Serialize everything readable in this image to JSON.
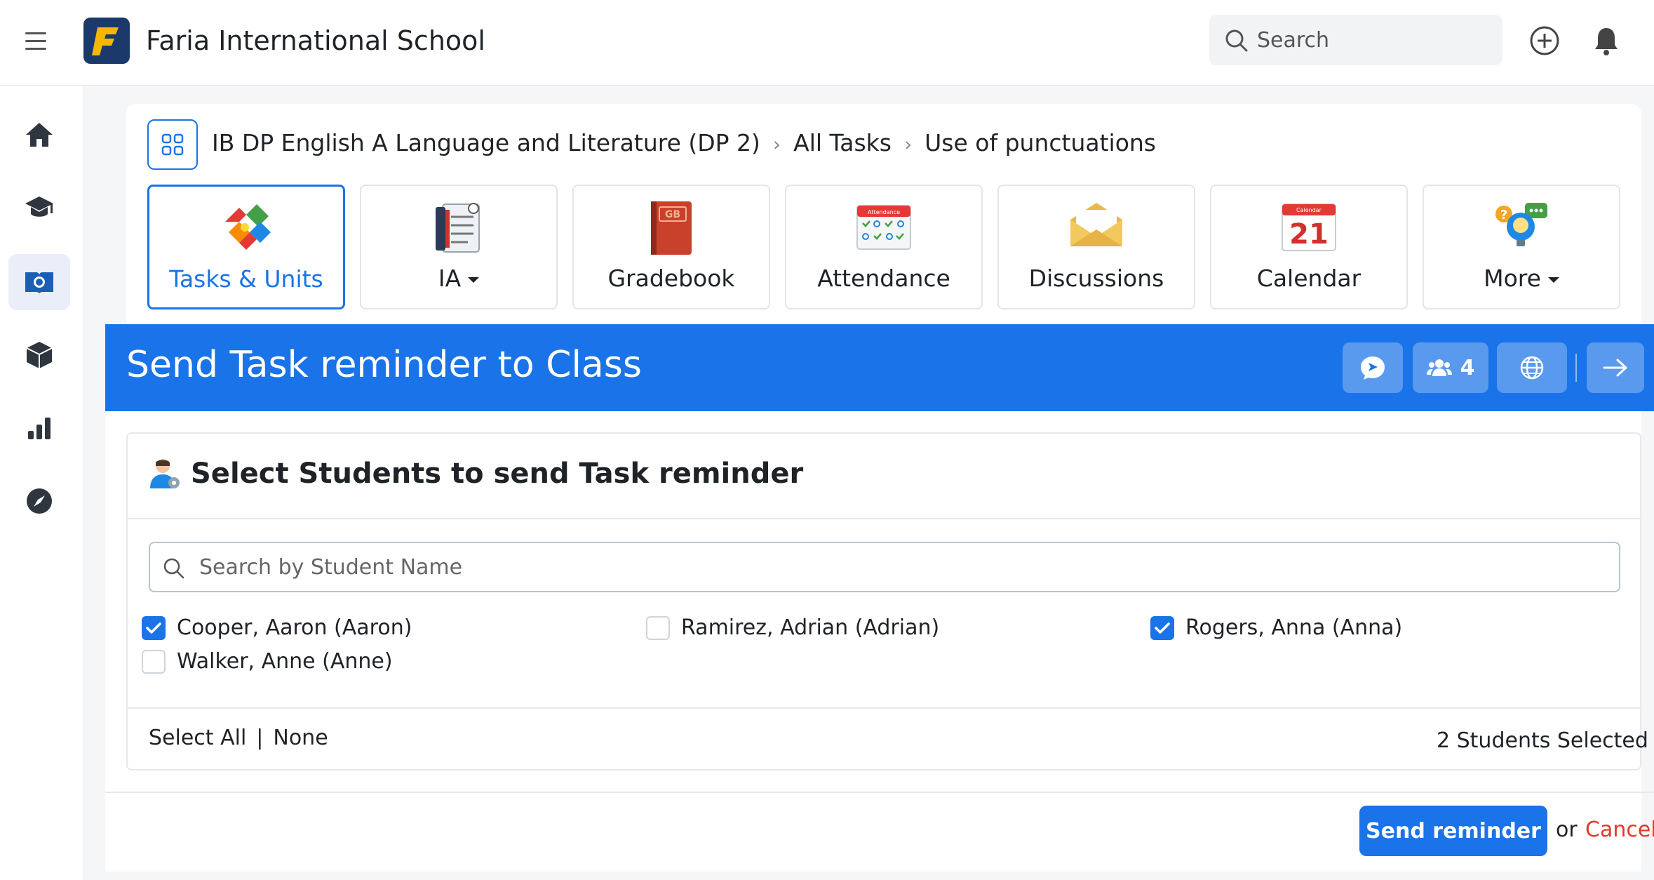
{
  "app": {
    "school_name": "Faria International School"
  },
  "topbar": {
    "search_placeholder": "Search",
    "icons": [
      "menu-icon",
      "search-icon",
      "add-circle-icon",
      "bell-icon"
    ]
  },
  "sidebar": {
    "items": [
      {
        "name": "home",
        "icon": "home-icon"
      },
      {
        "name": "academics",
        "icon": "graduation-cap-icon"
      },
      {
        "name": "classes",
        "icon": "globe-book-icon",
        "active": true
      },
      {
        "name": "resources",
        "icon": "cube-icon"
      },
      {
        "name": "reports",
        "icon": "bar-chart-icon"
      },
      {
        "name": "explore",
        "icon": "compass-icon"
      }
    ]
  },
  "breadcrumb": {
    "course": "IB DP English A Language and Literature (DP 2)",
    "section": "All Tasks",
    "current": "Use of punctuations"
  },
  "tiles": [
    {
      "label": "Tasks & Units",
      "icon": "puzzle-icon",
      "active": true
    },
    {
      "label": "IA",
      "icon": "checklist-icon",
      "dropdown": true
    },
    {
      "label": "Gradebook",
      "icon": "gradebook-icon",
      "icon_text": "GB"
    },
    {
      "label": "Attendance",
      "icon": "attendance-calendar-icon",
      "icon_text": "Attendance"
    },
    {
      "label": "Discussions",
      "icon": "envelope-icon"
    },
    {
      "label": "Calendar",
      "icon": "calendar-icon",
      "icon_text": "21",
      "icon_subtext": "Calendar"
    },
    {
      "label": "More",
      "icon": "lightbulb-chat-icon",
      "dropdown": true
    }
  ],
  "panel": {
    "title": "Send Task reminder to Class",
    "header_buttons": [
      {
        "name": "message",
        "icon": "chat-bubble-icon"
      },
      {
        "name": "members",
        "icon": "users-icon",
        "count": "4"
      },
      {
        "name": "language",
        "icon": "globe-icon"
      },
      {
        "name": "next",
        "icon": "arrow-right-icon"
      }
    ]
  },
  "students_section": {
    "title": "Select Students to send Task reminder",
    "search_placeholder": "Search by Student Name",
    "students": [
      {
        "name": "Cooper, Aaron (Aaron)",
        "checked": true
      },
      {
        "name": "Ramirez, Adrian (Adrian)",
        "checked": false
      },
      {
        "name": "Rogers, Anna (Anna)",
        "checked": true
      },
      {
        "name": "Walker, Anne (Anne)",
        "checked": false
      }
    ],
    "select_all": "Select All",
    "select_none": "None",
    "selected_count": "2 Students Selected"
  },
  "footer": {
    "send_label": "Send reminder",
    "or_text": "or",
    "cancel_label": "Cancel"
  },
  "colors": {
    "accent": "#1a73e8",
    "cancel": "#e0392b"
  }
}
